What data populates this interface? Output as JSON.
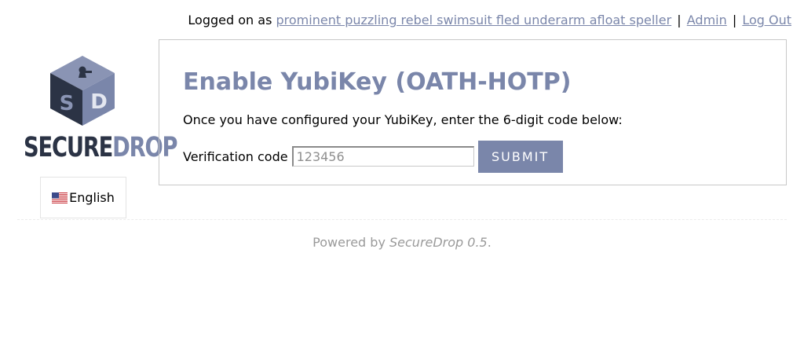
{
  "header": {
    "logged_on_prefix": "Logged on as",
    "username": "prominent puzzling rebel swimsuit fled underarm afloat speller",
    "separator": "|",
    "admin_link": "Admin",
    "logout_link": "Log Out"
  },
  "logo": {
    "word_dark": "SECURE",
    "word_light": "DROP",
    "cube_letter_left": "S",
    "cube_letter_right": "D"
  },
  "language": {
    "selected": "English",
    "flag": "us-flag-icon"
  },
  "main": {
    "title": "Enable YubiKey (OATH-HOTP)",
    "instructions": "Once you have configured your YubiKey, enter the 6-digit code below:",
    "field_label": "Verification code",
    "field_placeholder": "123456",
    "field_value": "",
    "submit_label": "SUBMIT"
  },
  "footer": {
    "prefix": "Powered by",
    "product": "SecureDrop 0.5",
    "suffix": "."
  },
  "colors": {
    "accent": "#7a86aa",
    "dark": "#2b3345",
    "muted": "#9a9a9a"
  }
}
